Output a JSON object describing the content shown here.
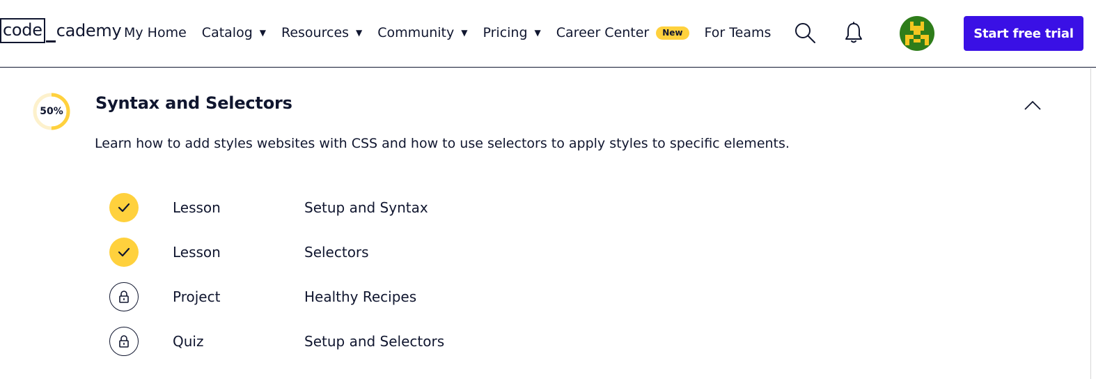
{
  "brand": {
    "logo_left": "code",
    "logo_right": "cademy"
  },
  "nav": {
    "items": [
      {
        "label": "My Home",
        "has_caret": false
      },
      {
        "label": "Catalog",
        "has_caret": true
      },
      {
        "label": "Resources",
        "has_caret": true
      },
      {
        "label": "Community",
        "has_caret": true
      },
      {
        "label": "Pricing",
        "has_caret": true
      },
      {
        "label": "Career Center",
        "has_caret": false,
        "badge": "New"
      },
      {
        "label": "For Teams",
        "has_caret": false
      }
    ],
    "caret_glyph": "▼"
  },
  "header": {
    "search_icon": "search-icon",
    "bell_icon": "bell-icon",
    "cta_label": "Start free trial",
    "colors": {
      "cta": "#3a10e5",
      "badge": "#ffd13d",
      "avatar_bg": "#2e7d1a",
      "avatar_fg": "#f4c620"
    }
  },
  "module": {
    "progress_label": "50%",
    "progress_value": 0.5,
    "title": "Syntax and Selectors",
    "description": "Learn how to add styles websites with CSS and how to use selectors to apply styles to specific elements.",
    "items": [
      {
        "type": "Lesson",
        "name": "Setup and Syntax",
        "status": "complete"
      },
      {
        "type": "Lesson",
        "name": "Selectors",
        "status": "complete"
      },
      {
        "type": "Project",
        "name": "Healthy Recipes",
        "status": "locked"
      },
      {
        "type": "Quiz",
        "name": "Setup and Selectors",
        "status": "locked"
      }
    ],
    "colors": {
      "progress": "#ffd13d",
      "progress_track": "#fdf1cc"
    }
  }
}
